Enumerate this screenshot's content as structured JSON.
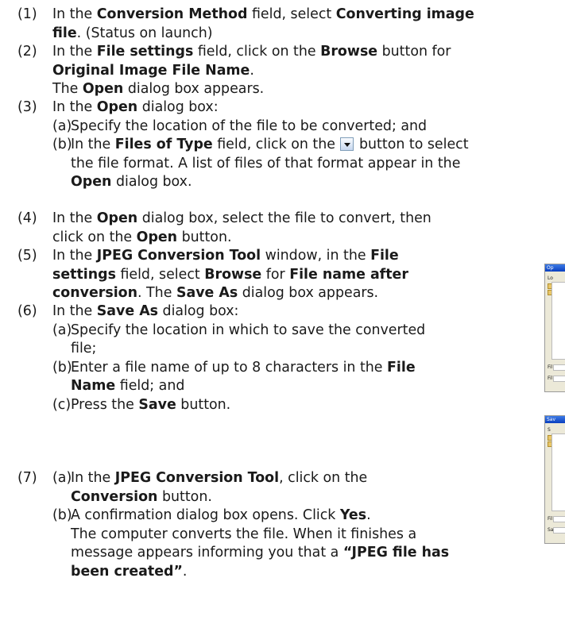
{
  "steps": {
    "s1": {
      "num": "(1)",
      "t1": "In the ",
      "b1": "Conversion Method",
      "t2": " field, select ",
      "b2": "Converting image",
      "b3": "file",
      "t3": ". (Status on launch)"
    },
    "s2": {
      "num": "(2)",
      "t1": "In the ",
      "b1": "File settings",
      "t2": " field, click on the ",
      "b2": "Browse",
      "t3": " button for",
      "b3": "Original Image File Name",
      "t4": ".",
      "t5": "The ",
      "b4": "Open",
      "t6": " dialog box appears."
    },
    "s3": {
      "num": "(3)",
      "t1": "In the ",
      "b1": "Open",
      "t2": " dialog box:",
      "a": {
        "lbl": "(a)",
        "t1": "Specify the location of the file to be converted; and"
      },
      "b": {
        "lbl": "(b)",
        "t1": "In the ",
        "b1": "Files of Type",
        "t2": " field, click on the ",
        "t3": " button to select",
        "t4": "the file format. A list of files of that format appear in the",
        "b2": "Open",
        "t5": " dialog box."
      }
    },
    "s4": {
      "num": "(4)",
      "t1": "In the ",
      "b1": "Open",
      "t2": " dialog box, select the file to convert, then",
      "t3": "click on the ",
      "b2": "Open",
      "t4": " button."
    },
    "s5": {
      "num": "(5)",
      "t1": "In the ",
      "b1": "JPEG Conversion Tool",
      "t2": " window, in the ",
      "b2": "File",
      "b3": "settings",
      "t3": " field, select ",
      "b4": "Browse",
      "t4": " for ",
      "b5": "File name after",
      "b6": "conversion",
      "t5": ". The ",
      "b7": "Save As",
      "t6": " dialog box appears."
    },
    "s6": {
      "num": "(6)",
      "t1": "In the ",
      "b1": "Save As",
      "t2": " dialog box:",
      "a": {
        "lbl": "(a)",
        "t1": "Specify the location in which to save the converted",
        "t2": "file;"
      },
      "b": {
        "lbl": "(b)",
        "t1": "Enter a file name of up to 8 characters in the ",
        "b1": "File",
        "b2": "Name",
        "t2": " field; and"
      },
      "c": {
        "lbl": "(c)",
        "t1": "Press the ",
        "b1": "Save",
        "t2": " button."
      }
    },
    "s7": {
      "num": "(7)",
      "a": {
        "lbl": "(a)",
        "t1": "In the ",
        "b1": "JPEG Conversion Tool",
        "t2": ", click on the",
        "b2": "Conversion",
        "t3": " button."
      },
      "b": {
        "lbl": "(b)",
        "t1": "A confirmation dialog box opens. Click ",
        "b1": "Yes",
        "t2": ".",
        "t3": "The computer converts the file. When it finishes a",
        "t4": "message  appears informing you that a ",
        "b2": "“JPEG file has",
        "b3": "been created”",
        "t5": "."
      }
    }
  },
  "thumbnails": {
    "open": {
      "title": "Op",
      "r1": "Lo",
      "r2": "Fil",
      "r3": "Fil"
    },
    "save": {
      "title": "Sav",
      "r1": "S",
      "r2": "Fil",
      "r3": "Sa"
    }
  },
  "icons": {
    "dropdown": "dropdown-arrow-button-icon"
  }
}
